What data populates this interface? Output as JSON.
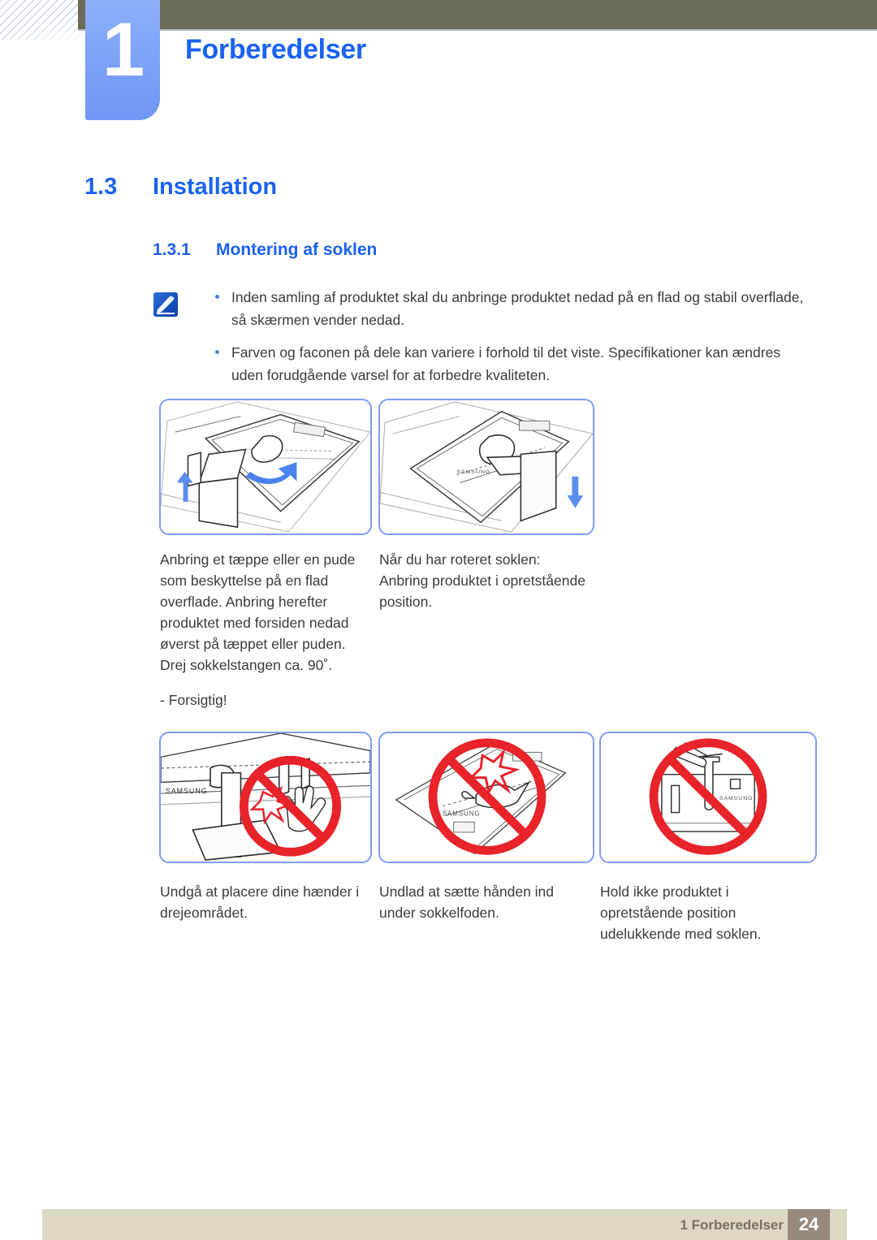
{
  "header": {
    "chapter_number": "1",
    "chapter_title": "Forberedelser",
    "accent_blue": "#1a62f0",
    "bar_color": "#6c6b57",
    "tab_color": "#7ea4f8"
  },
  "headings": {
    "section_number": "1.3",
    "section_title": "Installation",
    "subsection_number": "1.3.1",
    "subsection_title": "Montering af soklen"
  },
  "note": {
    "icon": "note-pen-icon",
    "items": [
      "Inden samling af produktet skal du anbringe produktet nedad på en flad og stabil overflade, så skærmen vender nedad.",
      "Farven og faconen på dele kan variere i forhold til det viste. Specifikationer kan ændres uden forudgående varsel for at forbedre kvaliteten."
    ]
  },
  "figures": {
    "assembly": [
      {
        "name": "monitor-face-down-rotate-stand",
        "caption": "Anbring et tæppe eller en pude som beskyttelse på en flad overflade. Anbring herefter produktet med forsiden nedad øverst på tæppet eller puden. Drej sokkelstangen ca. 90˚."
      },
      {
        "name": "monitor-stand-rotated-upright",
        "caption": "Når du har roteret soklen: Anbring produktet i opretstående position."
      }
    ],
    "caution_label": "- Forsigtig!",
    "warnings": [
      {
        "name": "no-hands-in-rotation-area",
        "caption": "Undgå at placere dine hænder i drejeområdet."
      },
      {
        "name": "no-hand-under-stand-base",
        "caption": "Undlad at sætte hånden ind under sokkelfoden."
      },
      {
        "name": "do-not-hold-upright-by-stand-only",
        "caption": "Hold ikke produktet i opretstående position udelukkende med soklen."
      }
    ],
    "prohibition_color": "#e8232a",
    "arrow_color": "#5b8def",
    "panel_border_color": "#7f9cf5"
  },
  "footer": {
    "label": "1 Forberedelser",
    "page_number": "24",
    "bar_color": "#ddd8c3",
    "page_box_color": "#97897c"
  }
}
